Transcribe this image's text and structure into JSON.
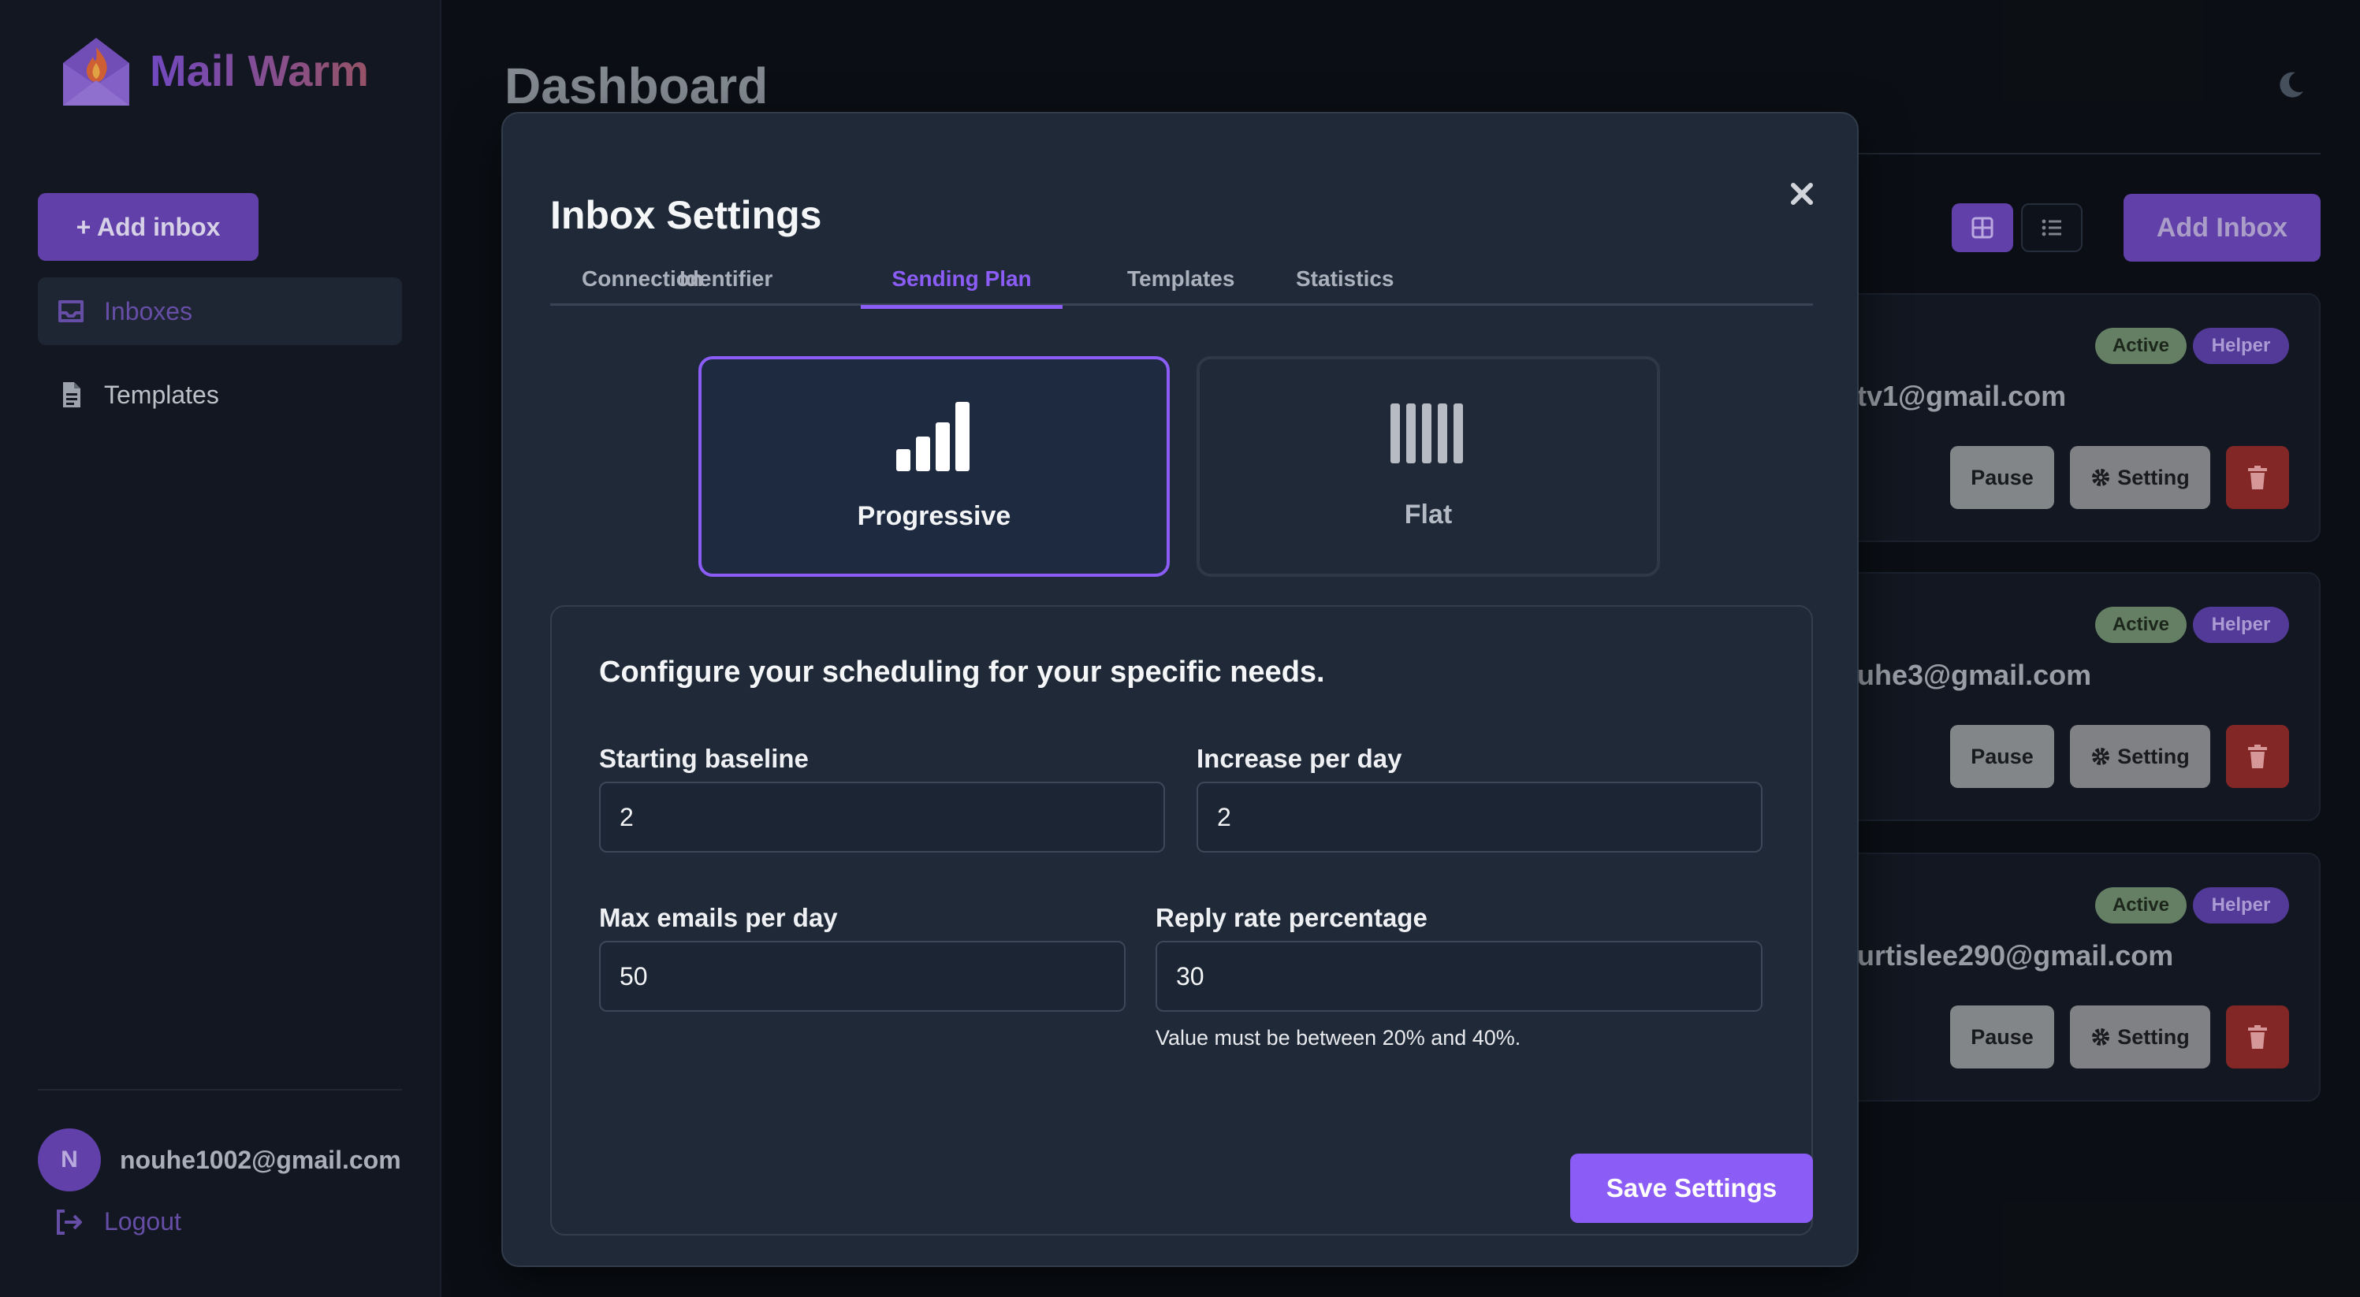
{
  "app": {
    "name": "Mail Warm"
  },
  "sidebar": {
    "add_inbox_label": "+ Add inbox",
    "items": [
      {
        "label": "Inboxes",
        "icon": "inbox-icon",
        "active": true
      },
      {
        "label": "Templates",
        "icon": "document-icon",
        "active": false
      }
    ],
    "user": {
      "initial": "N",
      "email": "nouhe1002@gmail.com"
    },
    "logout_label": "Logout"
  },
  "main": {
    "title": "Dashboard",
    "add_inbox_label": "Add Inbox",
    "cards": [
      {
        "email": "tv1@gmail.com",
        "status": "Active",
        "role": "Helper",
        "pause": "Pause",
        "setting": "Setting"
      },
      {
        "email": "uhe3@gmail.com",
        "status": "Active",
        "role": "Helper",
        "pause": "Pause",
        "setting": "Setting"
      },
      {
        "email": "urtislee290@gmail.com",
        "status": "Active",
        "role": "Helper",
        "pause": "Pause",
        "setting": "Setting"
      }
    ]
  },
  "modal": {
    "title": "Inbox Settings",
    "tabs": [
      {
        "label": "Connection"
      },
      {
        "label": "Identifier"
      },
      {
        "label": "Sending Plan",
        "active": true
      },
      {
        "label": "Templates"
      },
      {
        "label": "Statistics"
      }
    ],
    "plans": [
      {
        "label": "Progressive",
        "selected": true,
        "icon": "progressive-bars-icon"
      },
      {
        "label": "Flat",
        "selected": false,
        "icon": "flat-bars-icon"
      }
    ],
    "config": {
      "heading": "Configure your scheduling for your specific needs.",
      "starting_baseline": {
        "label": "Starting baseline",
        "value": "2"
      },
      "increase_per_day": {
        "label": "Increase per day",
        "value": "2"
      },
      "max_emails": {
        "label": "Max emails per day",
        "value": "50"
      },
      "reply_rate": {
        "label": "Reply rate percentage",
        "value": "30",
        "hint": "Value must be between 20% and 40%."
      }
    },
    "save_label": "Save Settings"
  },
  "colors": {
    "accent": "#8b5cf6",
    "accent_dim": "#6a46b8",
    "danger": "#8e2a2a",
    "active_badge": "#6d8a6c"
  }
}
